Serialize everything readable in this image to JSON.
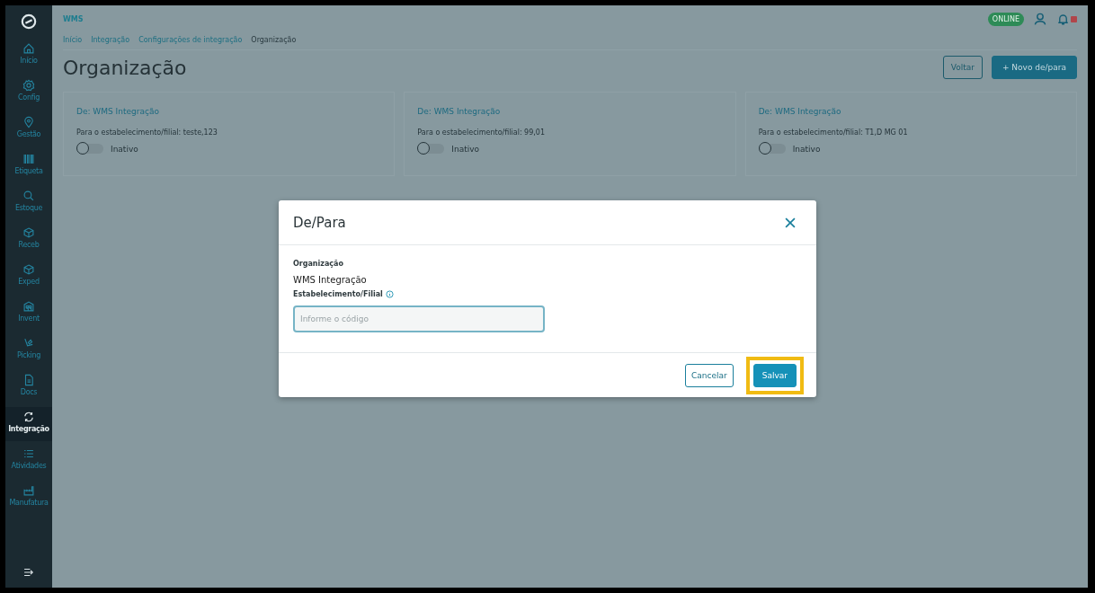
{
  "app": {
    "title": "WMS",
    "status": "ONLINE"
  },
  "sidebar": {
    "items": [
      {
        "label": "Início",
        "selected": false
      },
      {
        "label": "Config",
        "selected": false
      },
      {
        "label": "Gestão",
        "selected": false
      },
      {
        "label": "Etiqueta",
        "selected": false
      },
      {
        "label": "Estoque",
        "selected": false
      },
      {
        "label": "Receb",
        "selected": false
      },
      {
        "label": "Exped",
        "selected": false
      },
      {
        "label": "Invent",
        "selected": false
      },
      {
        "label": "Picking",
        "selected": false
      },
      {
        "label": "Docs",
        "selected": false
      },
      {
        "label": "Integração",
        "selected": true
      },
      {
        "label": "Atividades",
        "selected": false
      },
      {
        "label": "Manufatura",
        "selected": false
      }
    ]
  },
  "breadcrumb": [
    "Início",
    "Integração",
    "Configurações de integração",
    "Organização"
  ],
  "page_title": "Organização",
  "actions": [
    {
      "label": "Voltar",
      "kind": "outline"
    },
    {
      "label": "+ Novo de/para",
      "kind": "primary"
    }
  ],
  "cards": [
    {
      "title": "De: WMS Integração",
      "detail": "Para o estabelecimento/filial: teste,123",
      "toggle": {
        "on": false,
        "label": "Inativo"
      }
    },
    {
      "title": "De: WMS Integração",
      "detail": "Para o estabelecimento/filial: 99,01",
      "toggle": {
        "on": false,
        "label": "Inativo"
      }
    },
    {
      "title": "De: WMS Integração",
      "detail": "Para o estabelecimento/filial: T1,D MG 01",
      "toggle": {
        "on": false,
        "label": "Inativo"
      }
    }
  ],
  "dialog": {
    "title": "De/Para",
    "fields": [
      {
        "label": "Organização",
        "value": "WMS Integração"
      }
    ],
    "input": {
      "label": "Estabelecimento/Filial",
      "placeholder": "Informe o código"
    },
    "buttons": [
      {
        "label": "Cancelar",
        "kind": "outline",
        "highlighted": false
      },
      {
        "label": "Salvar",
        "kind": "primary",
        "highlighted": true
      }
    ]
  }
}
